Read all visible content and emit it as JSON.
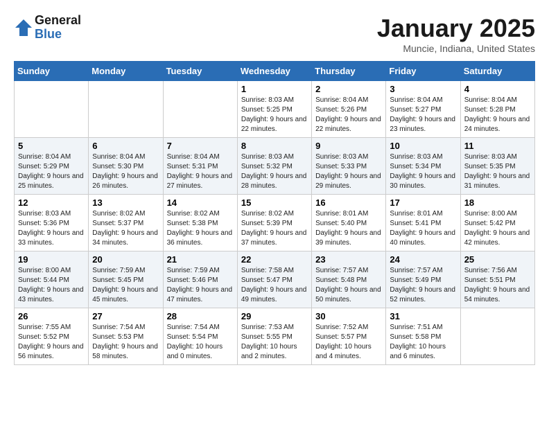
{
  "logo": {
    "general": "General",
    "blue": "Blue"
  },
  "title": "January 2025",
  "subtitle": "Muncie, Indiana, United States",
  "weekdays": [
    "Sunday",
    "Monday",
    "Tuesday",
    "Wednesday",
    "Thursday",
    "Friday",
    "Saturday"
  ],
  "weeks": [
    [
      {
        "day": "",
        "sunrise": "",
        "sunset": "",
        "daylight": ""
      },
      {
        "day": "",
        "sunrise": "",
        "sunset": "",
        "daylight": ""
      },
      {
        "day": "",
        "sunrise": "",
        "sunset": "",
        "daylight": ""
      },
      {
        "day": "1",
        "sunrise": "Sunrise: 8:03 AM",
        "sunset": "Sunset: 5:25 PM",
        "daylight": "Daylight: 9 hours and 22 minutes."
      },
      {
        "day": "2",
        "sunrise": "Sunrise: 8:04 AM",
        "sunset": "Sunset: 5:26 PM",
        "daylight": "Daylight: 9 hours and 22 minutes."
      },
      {
        "day": "3",
        "sunrise": "Sunrise: 8:04 AM",
        "sunset": "Sunset: 5:27 PM",
        "daylight": "Daylight: 9 hours and 23 minutes."
      },
      {
        "day": "4",
        "sunrise": "Sunrise: 8:04 AM",
        "sunset": "Sunset: 5:28 PM",
        "daylight": "Daylight: 9 hours and 24 minutes."
      }
    ],
    [
      {
        "day": "5",
        "sunrise": "Sunrise: 8:04 AM",
        "sunset": "Sunset: 5:29 PM",
        "daylight": "Daylight: 9 hours and 25 minutes."
      },
      {
        "day": "6",
        "sunrise": "Sunrise: 8:04 AM",
        "sunset": "Sunset: 5:30 PM",
        "daylight": "Daylight: 9 hours and 26 minutes."
      },
      {
        "day": "7",
        "sunrise": "Sunrise: 8:04 AM",
        "sunset": "Sunset: 5:31 PM",
        "daylight": "Daylight: 9 hours and 27 minutes."
      },
      {
        "day": "8",
        "sunrise": "Sunrise: 8:03 AM",
        "sunset": "Sunset: 5:32 PM",
        "daylight": "Daylight: 9 hours and 28 minutes."
      },
      {
        "day": "9",
        "sunrise": "Sunrise: 8:03 AM",
        "sunset": "Sunset: 5:33 PM",
        "daylight": "Daylight: 9 hours and 29 minutes."
      },
      {
        "day": "10",
        "sunrise": "Sunrise: 8:03 AM",
        "sunset": "Sunset: 5:34 PM",
        "daylight": "Daylight: 9 hours and 30 minutes."
      },
      {
        "day": "11",
        "sunrise": "Sunrise: 8:03 AM",
        "sunset": "Sunset: 5:35 PM",
        "daylight": "Daylight: 9 hours and 31 minutes."
      }
    ],
    [
      {
        "day": "12",
        "sunrise": "Sunrise: 8:03 AM",
        "sunset": "Sunset: 5:36 PM",
        "daylight": "Daylight: 9 hours and 33 minutes."
      },
      {
        "day": "13",
        "sunrise": "Sunrise: 8:02 AM",
        "sunset": "Sunset: 5:37 PM",
        "daylight": "Daylight: 9 hours and 34 minutes."
      },
      {
        "day": "14",
        "sunrise": "Sunrise: 8:02 AM",
        "sunset": "Sunset: 5:38 PM",
        "daylight": "Daylight: 9 hours and 36 minutes."
      },
      {
        "day": "15",
        "sunrise": "Sunrise: 8:02 AM",
        "sunset": "Sunset: 5:39 PM",
        "daylight": "Daylight: 9 hours and 37 minutes."
      },
      {
        "day": "16",
        "sunrise": "Sunrise: 8:01 AM",
        "sunset": "Sunset: 5:40 PM",
        "daylight": "Daylight: 9 hours and 39 minutes."
      },
      {
        "day": "17",
        "sunrise": "Sunrise: 8:01 AM",
        "sunset": "Sunset: 5:41 PM",
        "daylight": "Daylight: 9 hours and 40 minutes."
      },
      {
        "day": "18",
        "sunrise": "Sunrise: 8:00 AM",
        "sunset": "Sunset: 5:42 PM",
        "daylight": "Daylight: 9 hours and 42 minutes."
      }
    ],
    [
      {
        "day": "19",
        "sunrise": "Sunrise: 8:00 AM",
        "sunset": "Sunset: 5:44 PM",
        "daylight": "Daylight: 9 hours and 43 minutes."
      },
      {
        "day": "20",
        "sunrise": "Sunrise: 7:59 AM",
        "sunset": "Sunset: 5:45 PM",
        "daylight": "Daylight: 9 hours and 45 minutes."
      },
      {
        "day": "21",
        "sunrise": "Sunrise: 7:59 AM",
        "sunset": "Sunset: 5:46 PM",
        "daylight": "Daylight: 9 hours and 47 minutes."
      },
      {
        "day": "22",
        "sunrise": "Sunrise: 7:58 AM",
        "sunset": "Sunset: 5:47 PM",
        "daylight": "Daylight: 9 hours and 49 minutes."
      },
      {
        "day": "23",
        "sunrise": "Sunrise: 7:57 AM",
        "sunset": "Sunset: 5:48 PM",
        "daylight": "Daylight: 9 hours and 50 minutes."
      },
      {
        "day": "24",
        "sunrise": "Sunrise: 7:57 AM",
        "sunset": "Sunset: 5:49 PM",
        "daylight": "Daylight: 9 hours and 52 minutes."
      },
      {
        "day": "25",
        "sunrise": "Sunrise: 7:56 AM",
        "sunset": "Sunset: 5:51 PM",
        "daylight": "Daylight: 9 hours and 54 minutes."
      }
    ],
    [
      {
        "day": "26",
        "sunrise": "Sunrise: 7:55 AM",
        "sunset": "Sunset: 5:52 PM",
        "daylight": "Daylight: 9 hours and 56 minutes."
      },
      {
        "day": "27",
        "sunrise": "Sunrise: 7:54 AM",
        "sunset": "Sunset: 5:53 PM",
        "daylight": "Daylight: 9 hours and 58 minutes."
      },
      {
        "day": "28",
        "sunrise": "Sunrise: 7:54 AM",
        "sunset": "Sunset: 5:54 PM",
        "daylight": "Daylight: 10 hours and 0 minutes."
      },
      {
        "day": "29",
        "sunrise": "Sunrise: 7:53 AM",
        "sunset": "Sunset: 5:55 PM",
        "daylight": "Daylight: 10 hours and 2 minutes."
      },
      {
        "day": "30",
        "sunrise": "Sunrise: 7:52 AM",
        "sunset": "Sunset: 5:57 PM",
        "daylight": "Daylight: 10 hours and 4 minutes."
      },
      {
        "day": "31",
        "sunrise": "Sunrise: 7:51 AM",
        "sunset": "Sunset: 5:58 PM",
        "daylight": "Daylight: 10 hours and 6 minutes."
      },
      {
        "day": "",
        "sunrise": "",
        "sunset": "",
        "daylight": ""
      }
    ]
  ]
}
